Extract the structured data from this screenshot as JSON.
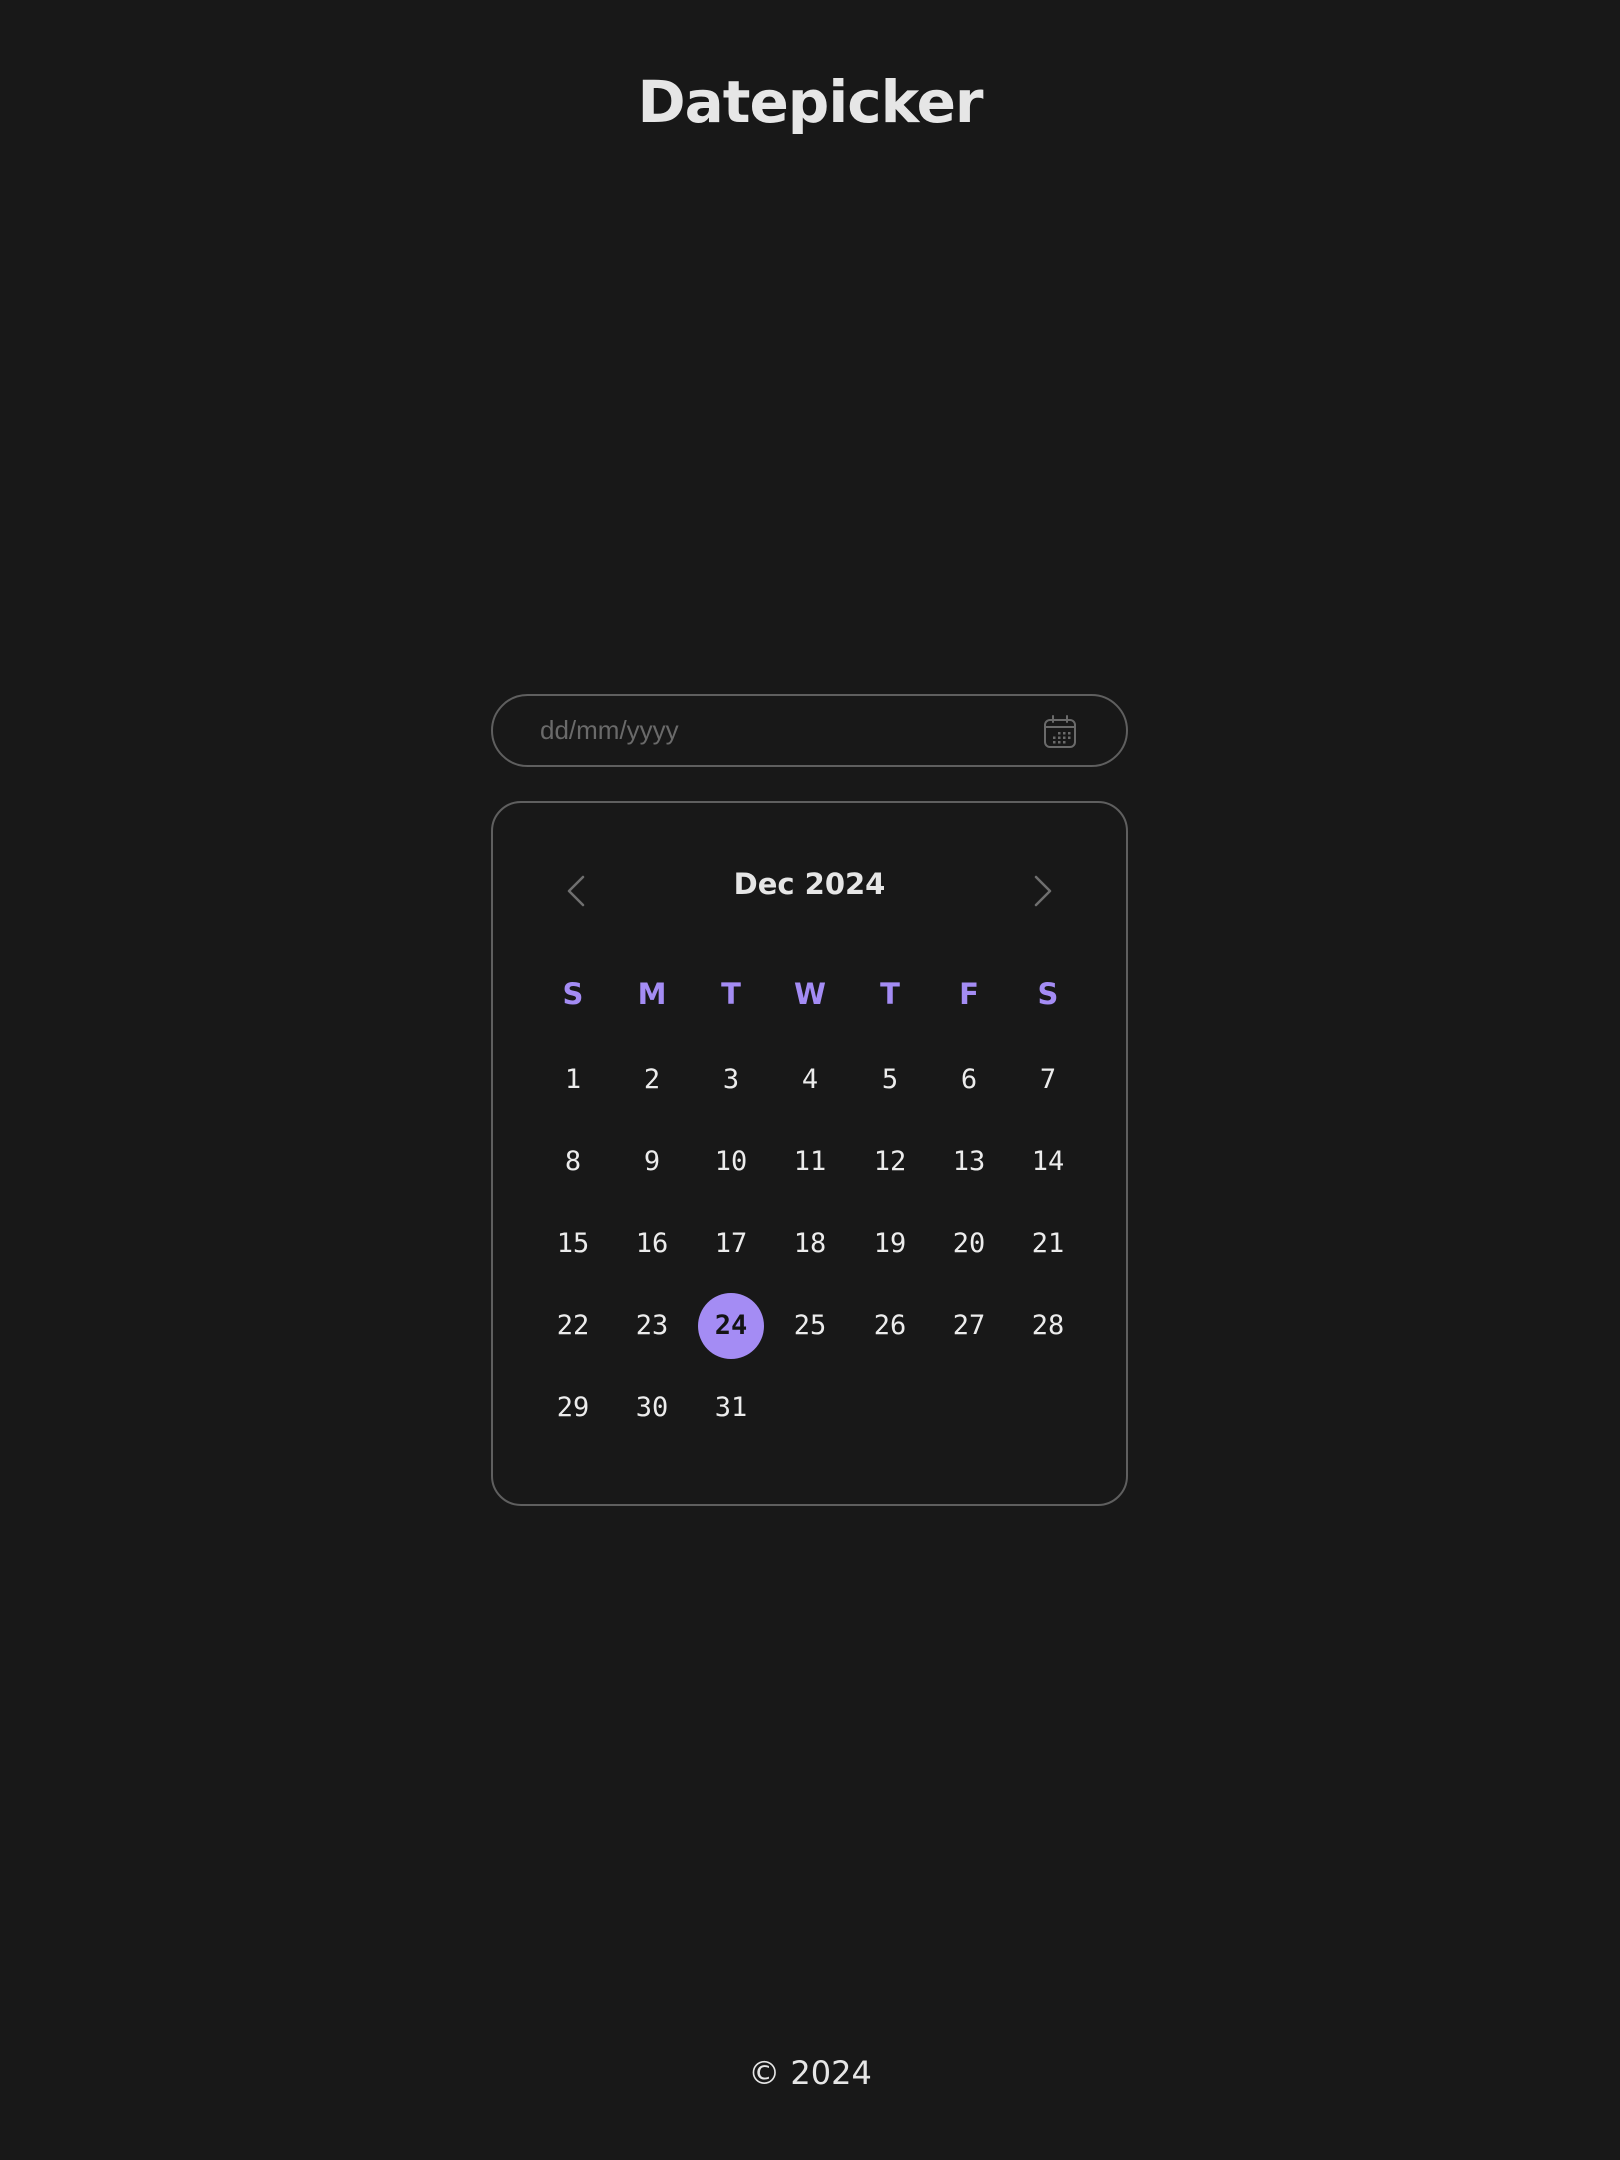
{
  "page": {
    "title": "Datepicker",
    "footer": "© 2024"
  },
  "date_input": {
    "placeholder": "dd/mm/yyyy",
    "value": "",
    "icon": "calendar-icon"
  },
  "calendar": {
    "month_label": "Dec 2024",
    "prev_icon": "chevron-left-icon",
    "next_icon": "chevron-right-icon",
    "weekdays": [
      "S",
      "M",
      "T",
      "W",
      "T",
      "F",
      "S"
    ],
    "first_weekday_index": 0,
    "days_in_month": 31,
    "days": [
      "1",
      "2",
      "3",
      "4",
      "5",
      "6",
      "7",
      "8",
      "9",
      "10",
      "11",
      "12",
      "13",
      "14",
      "15",
      "16",
      "17",
      "18",
      "19",
      "20",
      "21",
      "22",
      "23",
      "24",
      "25",
      "26",
      "27",
      "28",
      "29",
      "30",
      "31"
    ],
    "selected_day": "24"
  },
  "colors": {
    "background": "#181818",
    "accent": "#a48cf4",
    "border": "#5f5f5f",
    "text": "#e6e6e6",
    "placeholder": "#6a6a6a"
  }
}
